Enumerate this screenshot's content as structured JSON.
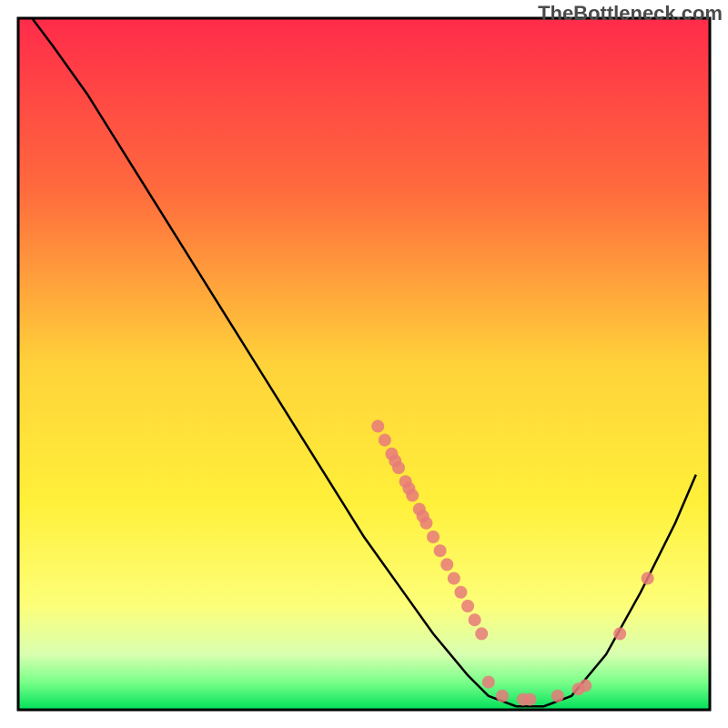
{
  "watermark": "TheBottleneck.com",
  "chart_data": {
    "type": "line",
    "title": "",
    "xlabel": "",
    "ylabel": "",
    "xlim": [
      0,
      100
    ],
    "ylim": [
      0,
      100
    ],
    "curve": [
      {
        "x": 2,
        "y": 100
      },
      {
        "x": 5,
        "y": 96
      },
      {
        "x": 10,
        "y": 89
      },
      {
        "x": 15,
        "y": 81
      },
      {
        "x": 20,
        "y": 73
      },
      {
        "x": 25,
        "y": 65
      },
      {
        "x": 30,
        "y": 57
      },
      {
        "x": 35,
        "y": 49
      },
      {
        "x": 40,
        "y": 41
      },
      {
        "x": 45,
        "y": 33
      },
      {
        "x": 50,
        "y": 25
      },
      {
        "x": 55,
        "y": 18
      },
      {
        "x": 60,
        "y": 11
      },
      {
        "x": 65,
        "y": 5
      },
      {
        "x": 68,
        "y": 2
      },
      {
        "x": 72,
        "y": 0.5
      },
      {
        "x": 76,
        "y": 0.5
      },
      {
        "x": 80,
        "y": 2
      },
      {
        "x": 85,
        "y": 8
      },
      {
        "x": 90,
        "y": 17
      },
      {
        "x": 95,
        "y": 27
      },
      {
        "x": 98,
        "y": 34
      }
    ],
    "scatter_points": [
      {
        "x": 52,
        "y": 41
      },
      {
        "x": 53,
        "y": 39
      },
      {
        "x": 54,
        "y": 37
      },
      {
        "x": 54.5,
        "y": 36
      },
      {
        "x": 55,
        "y": 35
      },
      {
        "x": 56,
        "y": 33
      },
      {
        "x": 56.5,
        "y": 32
      },
      {
        "x": 57,
        "y": 31
      },
      {
        "x": 58,
        "y": 29
      },
      {
        "x": 58.5,
        "y": 28
      },
      {
        "x": 59,
        "y": 27
      },
      {
        "x": 60,
        "y": 25
      },
      {
        "x": 61,
        "y": 23
      },
      {
        "x": 62,
        "y": 21
      },
      {
        "x": 63,
        "y": 19
      },
      {
        "x": 64,
        "y": 17
      },
      {
        "x": 65,
        "y": 15
      },
      {
        "x": 66,
        "y": 13
      },
      {
        "x": 67,
        "y": 11
      },
      {
        "x": 68,
        "y": 4
      },
      {
        "x": 70,
        "y": 2
      },
      {
        "x": 73,
        "y": 1.5
      },
      {
        "x": 74,
        "y": 1.5
      },
      {
        "x": 78,
        "y": 2
      },
      {
        "x": 81,
        "y": 3
      },
      {
        "x": 82,
        "y": 3.5
      },
      {
        "x": 87,
        "y": 11
      },
      {
        "x": 91,
        "y": 19
      }
    ],
    "gradient_stops": [
      {
        "offset": 0,
        "color": "#ff2b4a"
      },
      {
        "offset": 25,
        "color": "#ff6b3d"
      },
      {
        "offset": 50,
        "color": "#ffd23a"
      },
      {
        "offset": 70,
        "color": "#fff03a"
      },
      {
        "offset": 85,
        "color": "#fdff7a"
      },
      {
        "offset": 92,
        "color": "#d8ffb0"
      },
      {
        "offset": 96,
        "color": "#7aff8a"
      },
      {
        "offset": 100,
        "color": "#00e05a"
      }
    ],
    "point_color": "#e77a7a",
    "line_color": "#000000"
  }
}
